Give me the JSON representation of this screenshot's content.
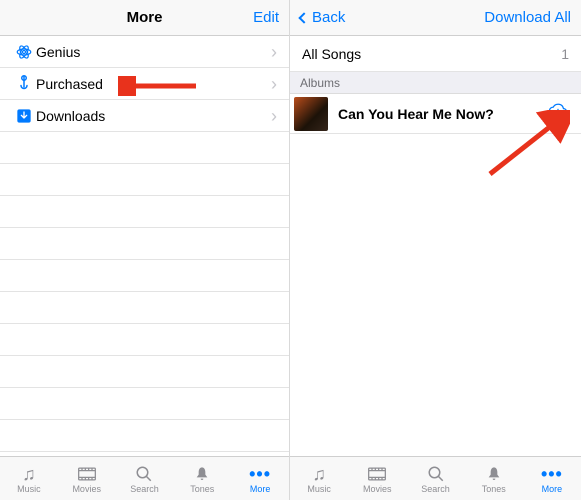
{
  "left": {
    "nav": {
      "title": "More",
      "edit": "Edit"
    },
    "rows": [
      {
        "icon": "genius-icon",
        "label": "Genius"
      },
      {
        "icon": "purchased-icon",
        "label": "Purchased"
      },
      {
        "icon": "downloads-icon",
        "label": "Downloads"
      }
    ],
    "tabs": [
      {
        "icon": "music-icon",
        "label": "Music"
      },
      {
        "icon": "movies-icon",
        "label": "Movies"
      },
      {
        "icon": "search-icon",
        "label": "Search"
      },
      {
        "icon": "tones-icon",
        "label": "Tones"
      },
      {
        "icon": "more-icon",
        "label": "More",
        "active": true
      }
    ]
  },
  "right": {
    "nav": {
      "back": "Back",
      "downloadAll": "Download All"
    },
    "allSongs": {
      "label": "All Songs",
      "count": "1"
    },
    "section": "Albums",
    "album": {
      "title": "Can You Hear Me Now?"
    },
    "tabs": [
      {
        "icon": "music-icon",
        "label": "Music"
      },
      {
        "icon": "movies-icon",
        "label": "Movies"
      },
      {
        "icon": "search-icon",
        "label": "Search"
      },
      {
        "icon": "tones-icon",
        "label": "Tones"
      },
      {
        "icon": "more-icon",
        "label": "More",
        "active": true
      }
    ]
  }
}
